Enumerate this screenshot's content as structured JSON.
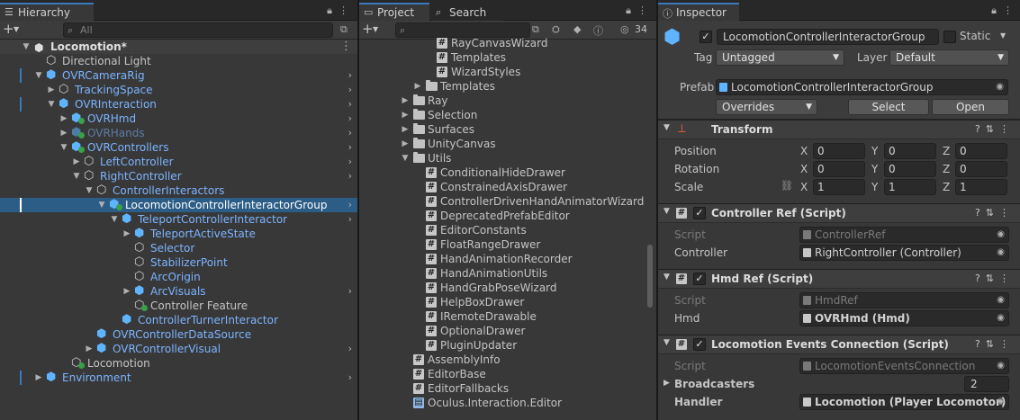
{
  "colors": {
    "accent": "#3a79bb",
    "selection": "#2c5d87",
    "prefab_blue": "#7cb4ff",
    "panel": "#383838"
  },
  "hierarchy": {
    "tab": "Hierarchy",
    "search_placeholder": "All",
    "items": [
      {
        "label": "Locomotion*",
        "style": "scene"
      },
      {
        "label": "Directional Light"
      },
      {
        "label": "OVRCameraRig"
      },
      {
        "label": "TrackingSpace"
      },
      {
        "label": "OVRInteraction"
      },
      {
        "label": "OVRHmd"
      },
      {
        "label": "OVRHands"
      },
      {
        "label": "OVRControllers"
      },
      {
        "label": "LeftController"
      },
      {
        "label": "RightController"
      },
      {
        "label": "ControllerInteractors"
      },
      {
        "label": "LocomotionControllerInteractorGroup"
      },
      {
        "label": "TeleportControllerInteractor"
      },
      {
        "label": "TeleportActiveState"
      },
      {
        "label": "Selector"
      },
      {
        "label": "StabilizerPoint"
      },
      {
        "label": "ArcOrigin"
      },
      {
        "label": "ArcVisuals"
      },
      {
        "label": "Controller Feature"
      },
      {
        "label": "ControllerTurnerInteractor"
      },
      {
        "label": "OVRControllerDataSource"
      },
      {
        "label": "OVRControllerVisual"
      },
      {
        "label": "Locomotion"
      },
      {
        "label": "Environment"
      }
    ]
  },
  "project": {
    "tabs": [
      "Project",
      "Search"
    ],
    "hidden_count": "34",
    "items": [
      {
        "label": "RayCanvasWizard"
      },
      {
        "label": "Templates"
      },
      {
        "label": "WizardStyles"
      },
      {
        "label": "Templates"
      },
      {
        "label": "Ray"
      },
      {
        "label": "Selection"
      },
      {
        "label": "Surfaces"
      },
      {
        "label": "UnityCanvas"
      },
      {
        "label": "Utils"
      },
      {
        "label": "ConditionalHideDrawer"
      },
      {
        "label": "ConstrainedAxisDrawer"
      },
      {
        "label": "ControllerDrivenHandAnimatorWizard"
      },
      {
        "label": "DeprecatedPrefabEditor"
      },
      {
        "label": "EditorConstants"
      },
      {
        "label": "FloatRangeDrawer"
      },
      {
        "label": "HandAnimationRecorder"
      },
      {
        "label": "HandAnimationUtils"
      },
      {
        "label": "HandGrabPoseWizard"
      },
      {
        "label": "HelpBoxDrawer"
      },
      {
        "label": "IRemoteDrawable"
      },
      {
        "label": "OptionalDrawer"
      },
      {
        "label": "PluginUpdater"
      },
      {
        "label": "AssemblyInfo"
      },
      {
        "label": "EditorBase"
      },
      {
        "label": "EditorFallbacks"
      },
      {
        "label": "Oculus.Interaction.Editor"
      }
    ]
  },
  "inspector": {
    "tab": "Inspector",
    "object_name": "LocomotionControllerInteractorGroup",
    "static_label": "Static",
    "tag_label": "Tag",
    "tag_value": "Untagged",
    "layer_label": "Layer",
    "layer_value": "Default",
    "prefab_label": "Prefab",
    "prefab_value": "LocomotionControllerInteractorGroup",
    "overrides_label": "Overrides",
    "select_label": "Select",
    "open_label": "Open",
    "transform": {
      "title": "Transform",
      "position_label": "Position",
      "rotation_label": "Rotation",
      "scale_label": "Scale",
      "x": "X",
      "y": "Y",
      "z": "Z",
      "position": [
        "0",
        "0",
        "0"
      ],
      "rotation": [
        "0",
        "0",
        "0"
      ],
      "scale": [
        "1",
        "1",
        "1"
      ]
    },
    "controller_ref": {
      "title": "Controller Ref (Script)",
      "script_label": "Script",
      "script_value": "ControllerRef",
      "field_label": "Controller",
      "field_value": "RightController (Controller)"
    },
    "hmd_ref": {
      "title": "Hmd Ref (Script)",
      "script_label": "Script",
      "script_value": "HmdRef",
      "field_label": "Hmd",
      "field_value": "OVRHmd (Hmd)"
    },
    "loco_events": {
      "title": "Locomotion Events Connection (Script)",
      "script_label": "Script",
      "script_value": "LocomotionEventsConnection",
      "broadcasters_label": "Broadcasters",
      "broadcasters_value": "2",
      "handler_label": "Handler",
      "handler_value": "Locomotion (Player Locomotor)"
    }
  }
}
